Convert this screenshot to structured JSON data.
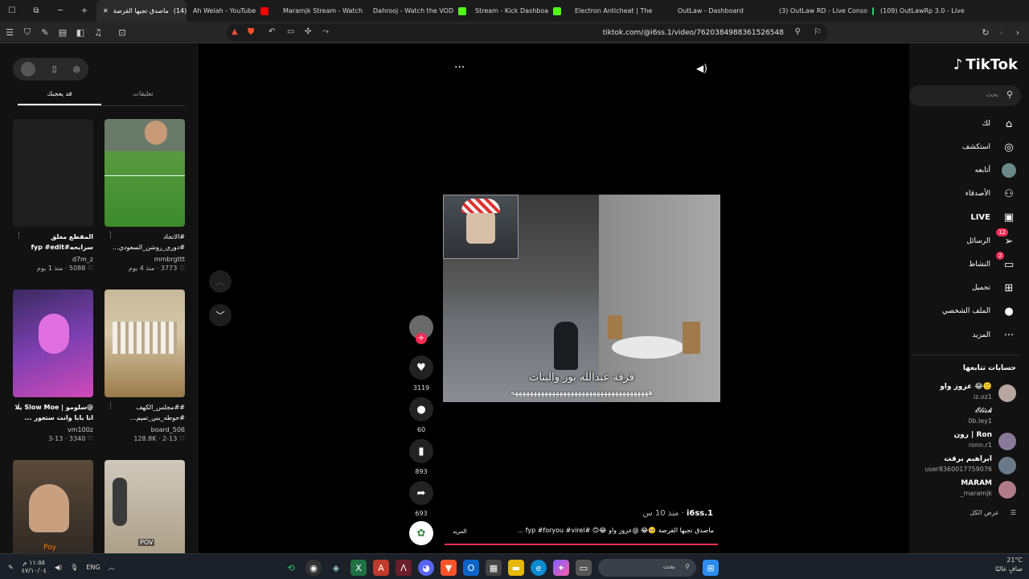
{
  "tabs": [
    {
      "label": "ماصدق تجيها القرصة",
      "badge": "(14)",
      "active": true
    },
    {
      "label": "Ah Welah - YouTube"
    },
    {
      "label": "Maramjk Stream - Watch"
    },
    {
      "label": "Dahrooj - Watch the VOD"
    },
    {
      "label": "Stream - Kick Dashboa"
    },
    {
      "label": "Electron Anticheat | The"
    },
    {
      "label": "OutLaw - Dashboard"
    },
    {
      "label": "(3) OutLaw RD - Live Conso"
    },
    {
      "label": "(109) OutLawRp 3.0 - Live"
    }
  ],
  "address": {
    "url": "tiktok.com/@i6ss.1/video/7620384988361526548"
  },
  "left_panel": {
    "tabs": {
      "comments": "تعليقات",
      "liked": "قد يعجبك"
    },
    "cards": [
      {
        "caption": "المقطع معلق سرابحه#fyp #edit",
        "user": "d7m_z",
        "likes": "5088",
        "age": "منذ 1 يوم"
      },
      {
        "caption": "#الاتحاد #دوري_روشن_السعودي...",
        "user": "mmbrgttt",
        "likes": "3773",
        "age": "منذ 4 يوم"
      },
      {
        "caption": "@سلومو | Slow Moe يلا انا بابا وانت ستعور ...",
        "user": "vm100z",
        "likes": "3340",
        "age": "3-13"
      },
      {
        "caption": "##مجلس_الكهف #حوطه_بني_تميم...",
        "user": "board_506",
        "likes": "128.8K",
        "age": "2-13"
      },
      {
        "caption": "",
        "user": "",
        "likes": "",
        "age": "",
        "overlay": "Poy"
      },
      {
        "caption": "",
        "user": "",
        "likes": "",
        "age": "",
        "overlay": "POV"
      }
    ]
  },
  "video": {
    "subtitle_line1": "فرقة عبدالله بوز والبنات",
    "subtitle_line2": "هههههههههههههههههههههههههههههههههههههه",
    "likes": "3119",
    "comments": "60",
    "saves": "893",
    "shares": "693",
    "author": "i6ss.1",
    "age": "منذ 10 س",
    "description": "ماصدق تجيها القرصة 🥺😂 @عزوز واو 😂🙃 #fyp #foryou #virel ...",
    "more_label": "المزيد"
  },
  "right_nav": {
    "brand": "TikTok",
    "search_placeholder": "بحث",
    "items": [
      {
        "label": "لك",
        "icon": "home-icon"
      },
      {
        "label": "استكشف",
        "icon": "compass-icon"
      },
      {
        "label": "أتابعه",
        "icon": "following-icon"
      },
      {
        "label": "الأصدقاء",
        "icon": "friends-icon"
      },
      {
        "label": "LIVE",
        "icon": "live-icon"
      },
      {
        "label": "الرسائل",
        "icon": "messages-icon",
        "badge": "12"
      },
      {
        "label": "النشاط",
        "icon": "activity-icon",
        "badge": "2"
      },
      {
        "label": "تحميل",
        "icon": "upload-icon"
      },
      {
        "label": "الملف الشخصي",
        "icon": "profile-icon"
      },
      {
        "label": "المزيد",
        "icon": "more-icon"
      }
    ],
    "following_title": "حسابات تتابعها",
    "following": [
      {
        "name": "عزوز واو 😂🙂",
        "handle": "iz.oz1"
      },
      {
        "name": "𝓔𝓵𝓲𝓼𝓱",
        "handle": "0b.ley1"
      },
      {
        "name": "رون | Ron",
        "handle": "ronn.r1"
      },
      {
        "name": "ابراهيم برقت",
        "handle": "user8360017759076"
      },
      {
        "name": "MARAM",
        "handle": "_maramjk"
      }
    ],
    "see_all": "عرض الكل"
  },
  "taskbar": {
    "time": "١١:٥٥ م",
    "date": "٤٧/١٠/٠٤",
    "lang": "ENG",
    "search_placeholder": "بحث",
    "weather_temp": "21°C",
    "weather_desc": "صافٍ غالبًا"
  }
}
